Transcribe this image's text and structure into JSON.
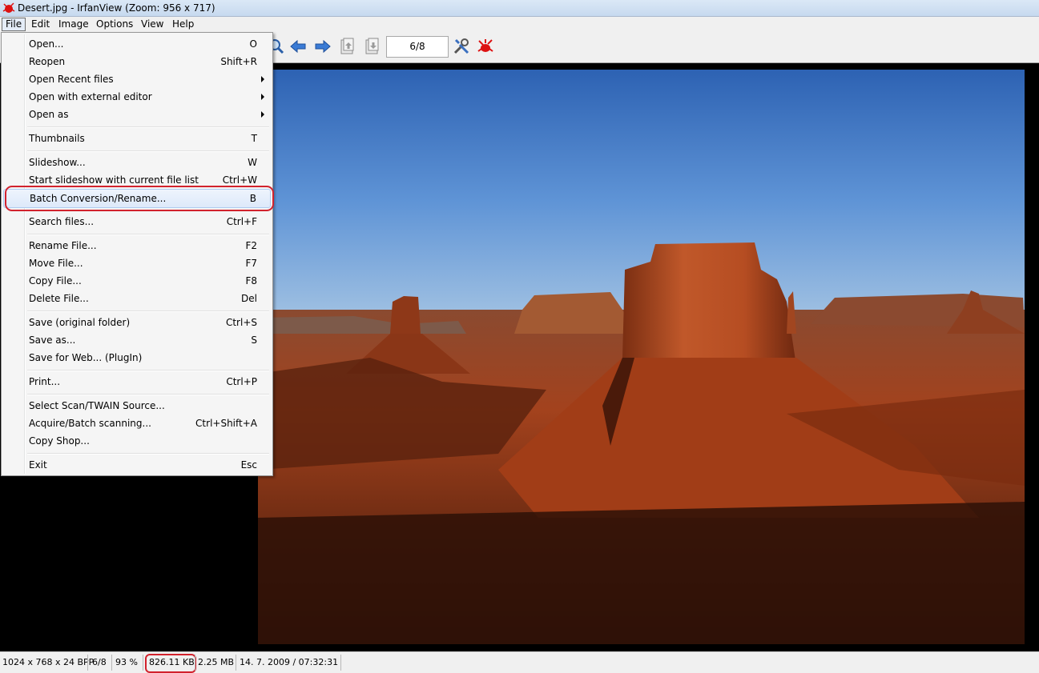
{
  "window": {
    "title": "Desert.jpg - IrfanView (Zoom: 956 x 717)"
  },
  "menubar": {
    "items": [
      "File",
      "Edit",
      "Image",
      "Options",
      "View",
      "Help"
    ]
  },
  "toolbar": {
    "page_counter": "6/8"
  },
  "file_menu": {
    "items": [
      {
        "label": "Open...",
        "shortcut": "O"
      },
      {
        "label": "Reopen",
        "shortcut": "Shift+R"
      },
      {
        "label": "Open Recent files",
        "shortcut": ""
      },
      {
        "label": "Open with external editor",
        "shortcut": ""
      },
      {
        "label": "Open as",
        "shortcut": ""
      },
      {
        "label": "Thumbnails",
        "shortcut": "T"
      },
      {
        "label": "Slideshow...",
        "shortcut": "W"
      },
      {
        "label": "Start slideshow with current file list",
        "shortcut": "Ctrl+W"
      },
      {
        "label": "Batch Conversion/Rename...",
        "shortcut": "B"
      },
      {
        "label": "Search files...",
        "shortcut": "Ctrl+F"
      },
      {
        "label": "Rename File...",
        "shortcut": "F2"
      },
      {
        "label": "Move File...",
        "shortcut": "F7"
      },
      {
        "label": "Copy File...",
        "shortcut": "F8"
      },
      {
        "label": "Delete File...",
        "shortcut": "Del"
      },
      {
        "label": "Save (original folder)",
        "shortcut": "Ctrl+S"
      },
      {
        "label": "Save as...",
        "shortcut": "S"
      },
      {
        "label": "Save for Web... (PlugIn)",
        "shortcut": ""
      },
      {
        "label": "Print...",
        "shortcut": "Ctrl+P"
      },
      {
        "label": "Select Scan/TWAIN Source...",
        "shortcut": ""
      },
      {
        "label": "Acquire/Batch scanning...",
        "shortcut": "Ctrl+Shift+A"
      },
      {
        "label": "Copy Shop...",
        "shortcut": ""
      },
      {
        "label": "Exit",
        "shortcut": "Esc"
      }
    ]
  },
  "statusbar": {
    "dimensions": "1024 x 768 x 24 BPP",
    "index": "6/8",
    "zoom": "93 %",
    "file_size": "826.11 KB",
    "memory": "2.25 MB",
    "date": "14. 7. 2009 / 07:32:31"
  },
  "colors": {
    "highlight_ring": "#d2222d",
    "menu_hover": "#dde9fa"
  }
}
